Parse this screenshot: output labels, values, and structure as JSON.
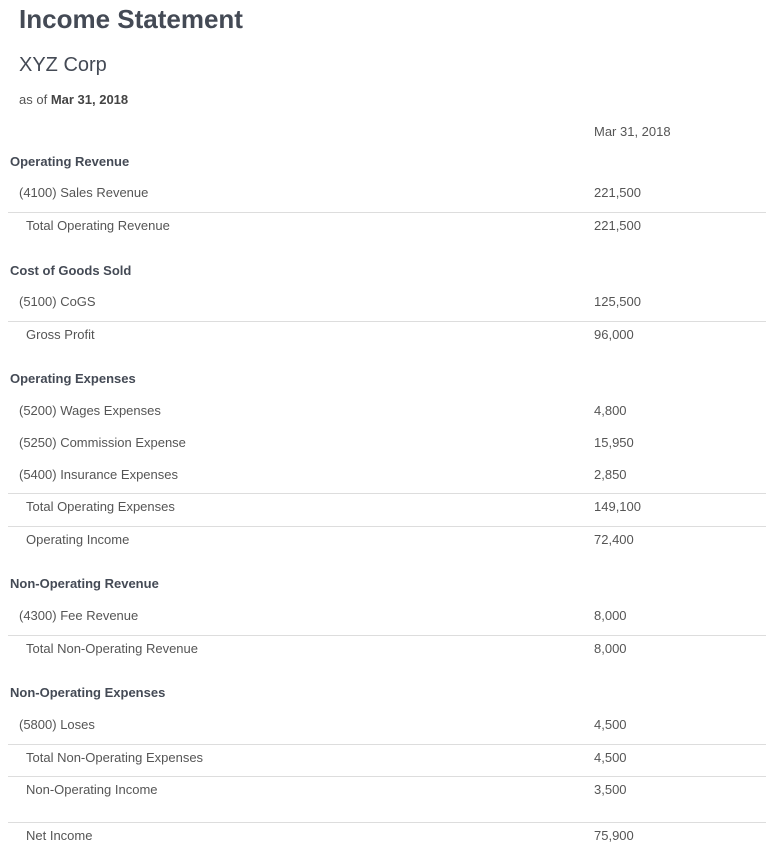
{
  "report": {
    "title": "Income Statement",
    "company": "XYZ Corp",
    "as_of_prefix": "as of",
    "as_of_date": "Mar 31, 2018",
    "column_header": "Mar 31, 2018"
  },
  "rows": [
    {
      "kind": "section",
      "label": "Operating Revenue",
      "value": ""
    },
    {
      "kind": "account",
      "label": "(4100) Sales Revenue",
      "value": "221,500"
    },
    {
      "kind": "total",
      "label": "Total Operating Revenue",
      "value": "221,500"
    },
    {
      "kind": "section",
      "label": "Cost of Goods Sold",
      "value": ""
    },
    {
      "kind": "account",
      "label": "(5100) CoGS",
      "value": "125,500"
    },
    {
      "kind": "total",
      "label": "Gross Profit",
      "value": "96,000"
    },
    {
      "kind": "section",
      "label": "Operating Expenses",
      "value": ""
    },
    {
      "kind": "account",
      "label": "(5200) Wages Expenses",
      "value": "4,800"
    },
    {
      "kind": "account",
      "label": "(5250) Commission Expense",
      "value": "15,950"
    },
    {
      "kind": "account",
      "label": "(5400) Insurance Expenses",
      "value": "2,850"
    },
    {
      "kind": "total",
      "label": "Total Operating Expenses",
      "value": "149,100"
    },
    {
      "kind": "total",
      "label": "Operating Income",
      "value": "72,400"
    },
    {
      "kind": "section",
      "label": "Non-Operating Revenue",
      "value": ""
    },
    {
      "kind": "account",
      "label": "(4300) Fee Revenue",
      "value": "8,000"
    },
    {
      "kind": "total",
      "label": "Total Non-Operating Revenue",
      "value": "8,000"
    },
    {
      "kind": "section",
      "label": "Non-Operating Expenses",
      "value": ""
    },
    {
      "kind": "account",
      "label": "(5800) Loses",
      "value": "4,500"
    },
    {
      "kind": "total",
      "label": "Total Non-Operating Expenses",
      "value": "4,500"
    },
    {
      "kind": "total",
      "label": "Non-Operating Income",
      "value": "3,500"
    },
    {
      "kind": "total",
      "label": "Net Income",
      "value": "75,900"
    }
  ]
}
